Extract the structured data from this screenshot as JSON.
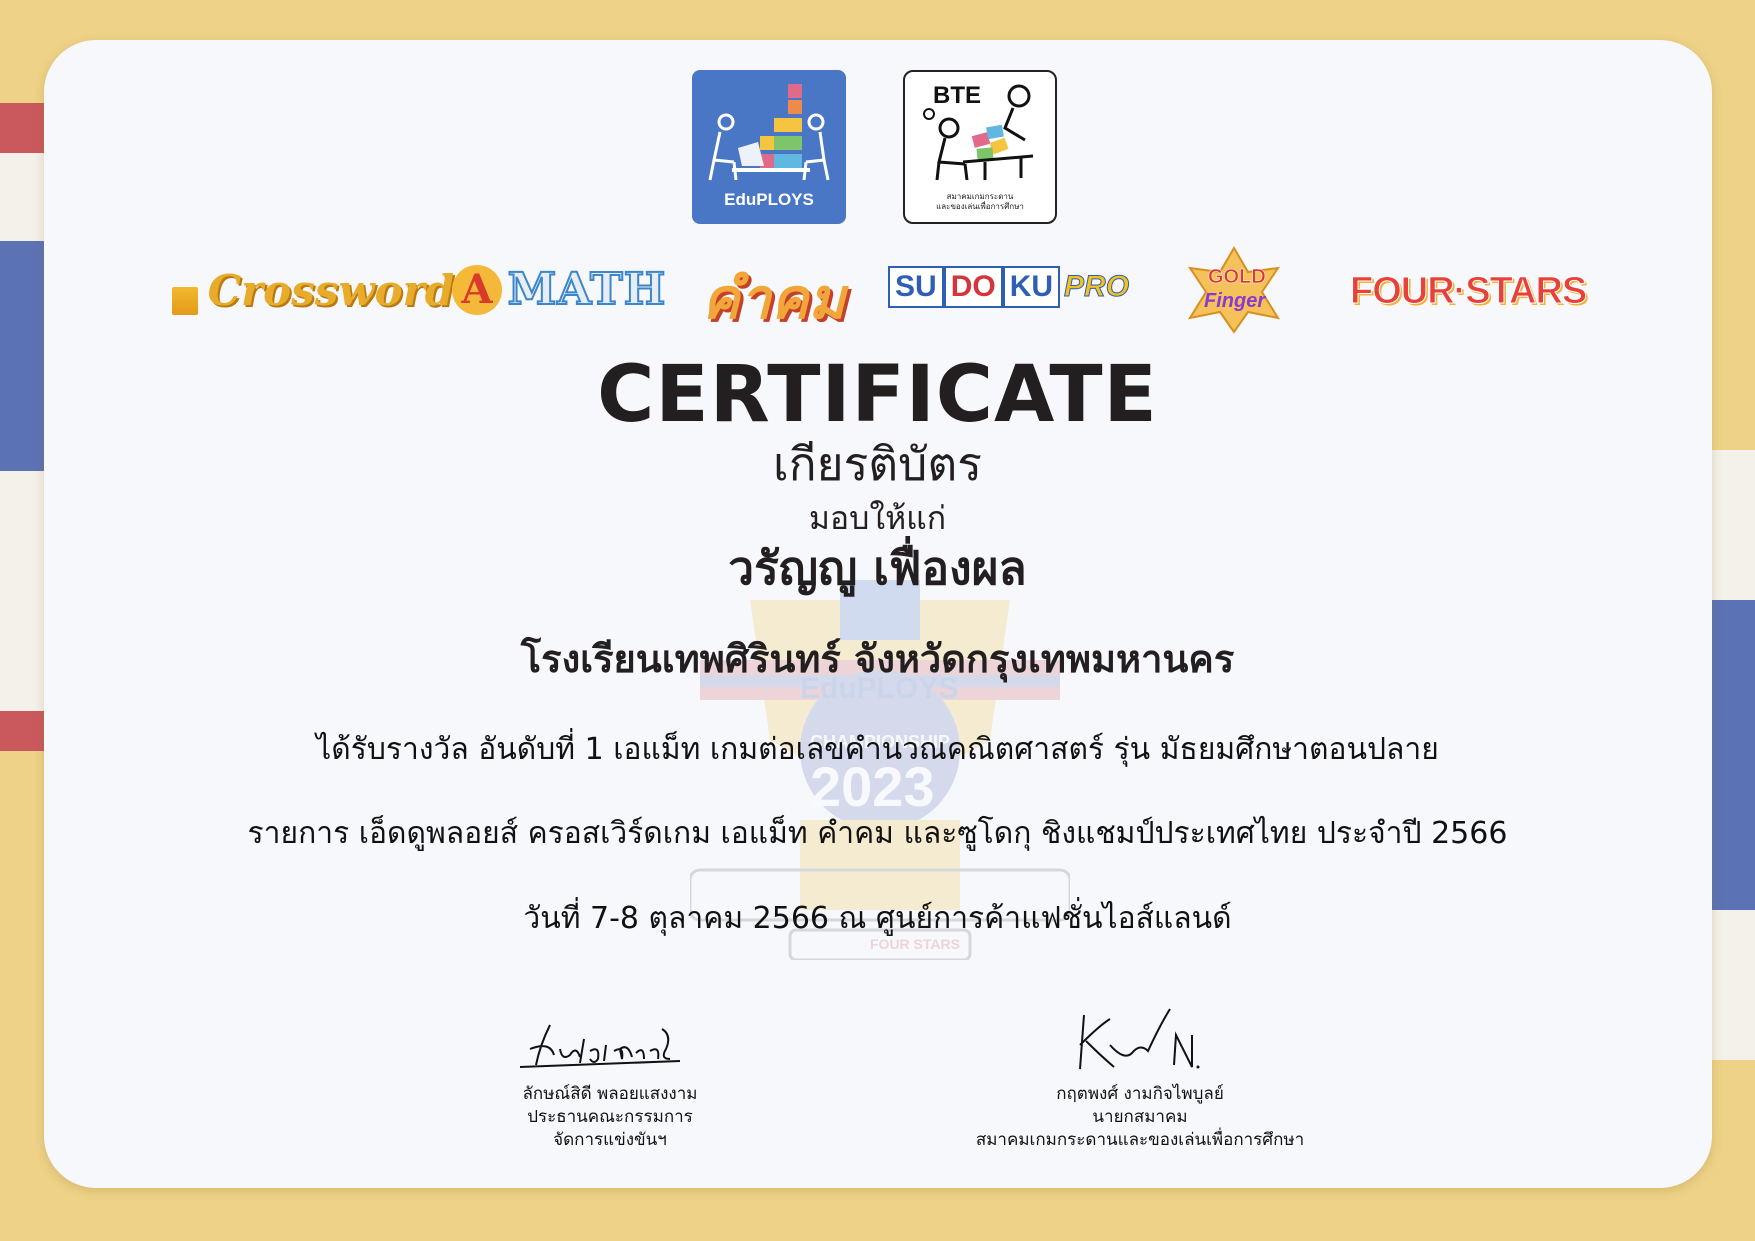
{
  "colors": {
    "background": "#eed287",
    "card": "#f7f8fc",
    "flag_red": "#c9595d",
    "flag_blue": "#5b72b5",
    "edu_blue": "#4a76c6",
    "text": "#231f20"
  },
  "logos": {
    "eduploys": "EduPLOYS",
    "bte": "BTE",
    "bte_sub_1": "สมาคมเกมกระดาน",
    "bte_sub_2": "และของเล่นเพื่อการศึกษา",
    "crossword": "Crossword",
    "amath_a": "A",
    "amath_rest": "MATH",
    "kham_khom": "คำคม",
    "sudoku_su": "SU",
    "sudoku_do": "DO",
    "sudoku_ku": "KU",
    "sudoku_pro": "PRO",
    "gold": "GOLD",
    "finger": "Finger",
    "four_stars": "FOUR·STARS"
  },
  "watermark": {
    "brand": "EduPLOYS",
    "championship": "CHAMPIONSHIP",
    "year": "2023",
    "four_stars": "FOUR STARS"
  },
  "certificate": {
    "title_en": "CERTIFICATE",
    "title_th": "เกียรติบัตร",
    "given_to": "มอบให้แก่",
    "recipient": "วรัญญู เฟื่องผล",
    "school": "โรงเรียนเทพศิรินทร์ จังหวัดกรุงเทพมหานคร",
    "line1": "ได้รับรางวัล อันดับที่ 1 เอแม็ท เกมต่อเลขคำนวณคณิตศาสตร์ รุ่น มัธยมศึกษาตอนปลาย",
    "line2": "รายการ เอ็ดดูพลอยส์ ครอสเวิร์ดเกม เอแม็ท คำคม และซูโดกุ ชิงแชมป์ประเทศไทย ประจำปี 2566",
    "line3": "วันที่ 7-8 ตุลาคม 2566 ณ ศูนย์การค้าแฟชั่นไอส์แลนด์"
  },
  "signatures": [
    {
      "signature_text": "Lukaideer",
      "name": "ลักษณ์สิดี พลอยแสงงาม",
      "title1": "ประธานคณะกรรมการ",
      "title2": "จัดการแข่งขันฯ"
    },
    {
      "signature_text": "K N.",
      "name": "กฤตพงศ์ งามกิจไพบูลย์",
      "title1": "นายกสมาคม",
      "title2": "สมาคมเกมกระดานและของเล่นเพื่อการศึกษา"
    }
  ]
}
